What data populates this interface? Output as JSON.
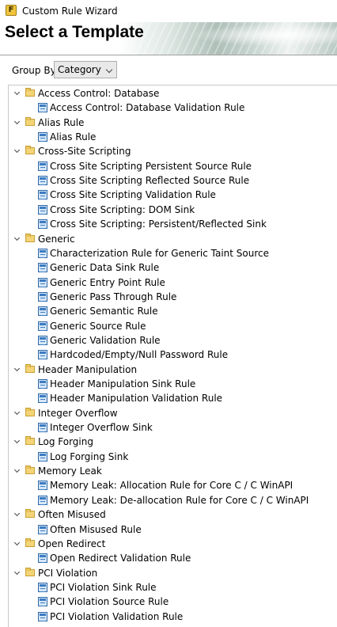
{
  "window": {
    "title": "Custom Rule Wizard",
    "app_icon_glyph": "F"
  },
  "header": {
    "title": "Select a Template"
  },
  "group_by": {
    "label": "Group By:",
    "value": "Category"
  },
  "tree": [
    {
      "name": "Access Control: Database",
      "rules": [
        "Access Control: Database Validation Rule"
      ]
    },
    {
      "name": "Alias Rule",
      "rules": [
        "Alias Rule"
      ]
    },
    {
      "name": "Cross-Site Scripting",
      "rules": [
        "Cross Site Scripting Persistent Source Rule",
        "Cross Site Scripting Reflected Source Rule",
        "Cross Site Scripting Validation Rule",
        "Cross Site Scripting: DOM Sink",
        "Cross Site Scripting: Persistent/Reflected Sink"
      ]
    },
    {
      "name": "Generic",
      "rules": [
        "Characterization Rule for Generic Taint Source",
        "Generic Data Sink Rule",
        "Generic Entry Point Rule",
        "Generic Pass Through Rule",
        "Generic Semantic Rule",
        "Generic Source Rule",
        "Generic Validation Rule",
        "Hardcoded/Empty/Null Password Rule"
      ]
    },
    {
      "name": "Header Manipulation",
      "rules": [
        "Header Manipulation Sink Rule",
        "Header Manipulation Validation Rule"
      ]
    },
    {
      "name": "Integer Overflow",
      "rules": [
        "Integer Overflow Sink"
      ]
    },
    {
      "name": "Log Forging",
      "rules": [
        "Log Forging Sink"
      ]
    },
    {
      "name": "Memory Leak",
      "rules": [
        "Memory Leak: Allocation Rule for Core C / C WinAPI",
        "Memory Leak: De-allocation Rule for Core C / C WinAPI"
      ]
    },
    {
      "name": "Often Misused",
      "rules": [
        "Often Misused Rule"
      ]
    },
    {
      "name": "Open Redirect",
      "rules": [
        "Open Redirect Validation Rule"
      ]
    },
    {
      "name": "PCI Violation",
      "rules": [
        "PCI Violation Sink Rule",
        "PCI Violation Source Rule",
        "PCI Violation Validation Rule"
      ]
    }
  ]
}
